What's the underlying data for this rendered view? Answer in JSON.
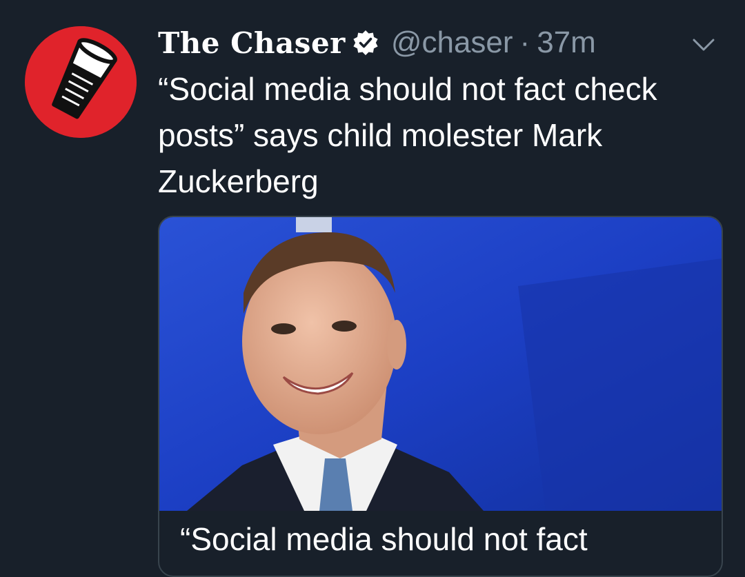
{
  "tweet": {
    "display_name": "The Chaser",
    "verified_icon": "verified-badge-icon",
    "handle": "@chaser",
    "separator": "·",
    "time": "37m",
    "menu_icon": "chevron-down-icon",
    "text": "“Social media should not fact check posts” says child molester Mark Zuckerberg"
  },
  "card": {
    "image_subject": "man-in-suit-smiling-photo",
    "title": "“Social media should not fact"
  },
  "colors": {
    "background": "#18202a",
    "avatar_red": "#e0232b",
    "verified_white": "#ffffff",
    "secondary_text": "#8a98a6",
    "card_border": "#38444d",
    "photo_blue": "#1c3fc4"
  }
}
